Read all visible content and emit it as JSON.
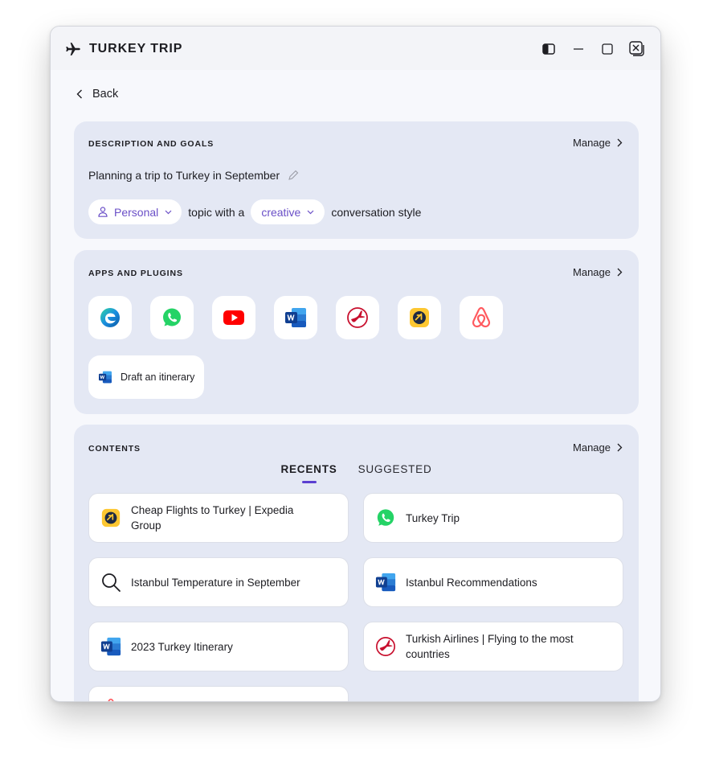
{
  "window": {
    "title": "TURKEY TRIP"
  },
  "nav": {
    "back_label": "Back"
  },
  "description": {
    "section_label": "DESCRIPTION AND GOALS",
    "manage_label": "Manage",
    "text": "Planning a trip to Turkey in September",
    "topic_value": "Personal",
    "topic_connector": "topic with a",
    "style_value": "creative",
    "style_suffix": "conversation style"
  },
  "apps": {
    "section_label": "APPS AND PLUGINS",
    "manage_label": "Manage",
    "items": [
      {
        "icon": "edge-icon"
      },
      {
        "icon": "whatsapp-icon"
      },
      {
        "icon": "youtube-icon"
      },
      {
        "icon": "word-icon"
      },
      {
        "icon": "turkish-airlines-icon"
      },
      {
        "icon": "expedia-icon"
      },
      {
        "icon": "airbnb-icon"
      }
    ],
    "action_label": "Draft an itinerary"
  },
  "contents": {
    "section_label": "CONTENTS",
    "manage_label": "Manage",
    "tabs": [
      {
        "label": "RECENTS",
        "active": true
      },
      {
        "label": "SUGGESTED",
        "active": false
      }
    ],
    "items": [
      {
        "icon": "expedia-icon",
        "title": "Cheap Flights to Turkey | Expedia Group"
      },
      {
        "icon": "whatsapp-icon",
        "title": "Turkey Trip"
      },
      {
        "icon": "search-icon",
        "title": "Istanbul Temperature in September"
      },
      {
        "icon": "word-icon",
        "title": "Istanbul Recommendations"
      },
      {
        "icon": "word-icon",
        "title": "2023 Turkey Itinerary"
      },
      {
        "icon": "turkish-airlines-icon",
        "title": "Turkish Airlines | Flying to the most countries"
      },
      {
        "icon": "airbnb-icon",
        "title": ""
      }
    ]
  },
  "colors": {
    "accent": "#5b3fd1",
    "pill_text": "#6a4fc7",
    "card_bg": "#e4e8f4",
    "whatsapp": "#25D366",
    "youtube": "#FF0000",
    "word": "#185ABD",
    "turkish_airlines": "#C8102E",
    "expedia": "#FDC731",
    "airbnb": "#FF5A5F"
  }
}
